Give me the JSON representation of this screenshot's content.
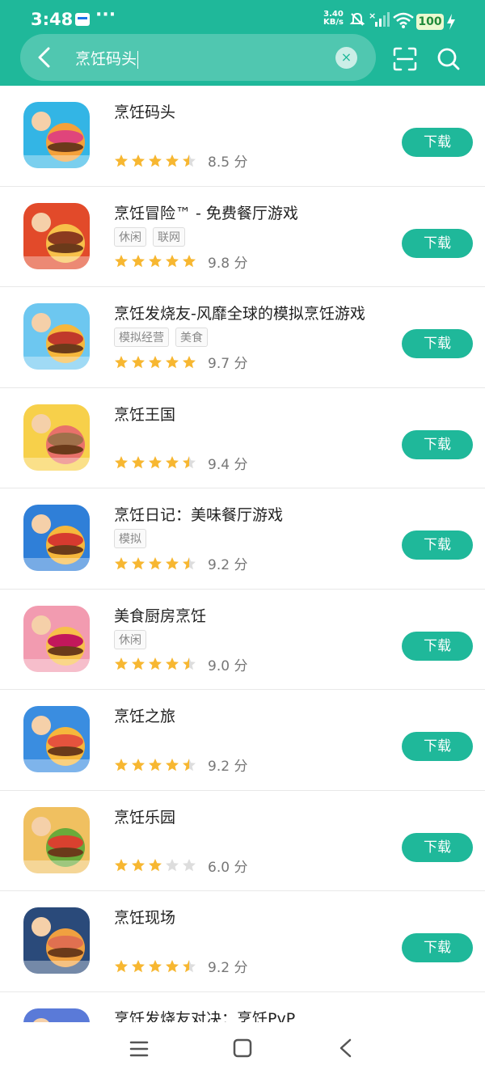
{
  "status": {
    "time": "3:48",
    "net_speed_value": "3.40",
    "net_speed_unit": "KB/s",
    "battery": "100"
  },
  "search": {
    "query": "烹饪码头"
  },
  "results": [
    {
      "name": "烹饪码头",
      "tags": [],
      "stars": 4.5,
      "score": "8.5 分",
      "download": "下载",
      "icon_colors": [
        "#33b5e5",
        "#e0457b",
        "#f4a13a"
      ]
    },
    {
      "name": "烹饪冒险™ - 免费餐厅游戏",
      "tags": [
        "休闲",
        "联网"
      ],
      "stars": 5,
      "score": "9.8 分",
      "download": "下载",
      "icon_colors": [
        "#e24a2a",
        "#8b3a1f",
        "#f7c04a"
      ]
    },
    {
      "name": "烹饪发烧友-风靡全球的模拟烹饪游戏",
      "tags": [
        "模拟经营",
        "美食"
      ],
      "stars": 5,
      "score": "9.7 分",
      "download": "下载",
      "icon_colors": [
        "#6dc7f0",
        "#c0392b",
        "#f6b73c"
      ]
    },
    {
      "name": "烹饪王国",
      "tags": [],
      "stars": 4.5,
      "score": "9.4 分",
      "download": "下载",
      "icon_colors": [
        "#f7d04a",
        "#a0704a",
        "#e8716a"
      ]
    },
    {
      "name": "烹饪日记：美味餐厅游戏",
      "tags": [
        "模拟"
      ],
      "stars": 4.5,
      "score": "9.2 分",
      "download": "下载",
      "icon_colors": [
        "#2f7fd8",
        "#d63a2f",
        "#f6b73c"
      ]
    },
    {
      "name": "美食厨房烹饪",
      "tags": [
        "休闲"
      ],
      "stars": 4.5,
      "score": "9.0 分",
      "download": "下载",
      "icon_colors": [
        "#f29bb0",
        "#c2185b",
        "#f7c04a"
      ]
    },
    {
      "name": "烹饪之旅",
      "tags": [],
      "stars": 4.5,
      "score": "9.2 分",
      "download": "下载",
      "icon_colors": [
        "#3a8de0",
        "#e5533d",
        "#f6b73c"
      ]
    },
    {
      "name": "烹饪乐园",
      "tags": [],
      "stars": 3,
      "score": "6.0 分",
      "download": "下载",
      "icon_colors": [
        "#f0c060",
        "#d9412f",
        "#6aaa3a"
      ]
    },
    {
      "name": "烹饪现场",
      "tags": [],
      "stars": 4.5,
      "score": "9.2 分",
      "download": "下载",
      "icon_colors": [
        "#2a4a7a",
        "#e07050",
        "#f0a040"
      ]
    },
    {
      "name": "烹饪发烧友对决：烹饪PvP",
      "tags": [],
      "stars": 0,
      "score": "",
      "download": "",
      "icon_colors": [
        "#5a7ad8",
        "#e05a3a",
        "#f6b73c"
      ]
    }
  ],
  "colors": {
    "accent": "#1fb89a",
    "star": "#f7b731",
    "star_empty": "#dddddd"
  }
}
